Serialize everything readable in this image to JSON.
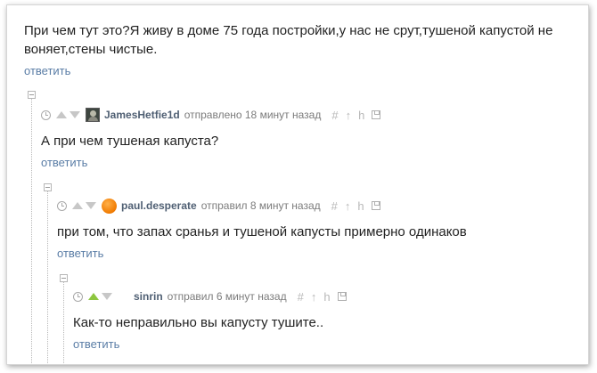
{
  "top_comment": {
    "text": "При чем тут это?Я живу в доме 75 года постройки,у нас не срут,тушеной капустой не воняет,стены чистые.",
    "reply_label": "ответить"
  },
  "comments": [
    {
      "username": "JamesHetfie1d",
      "action": "отправлено 18 минут назад",
      "text": "А при чем тушеная капуста?",
      "reply_label": "ответить",
      "avatar": "user-photo"
    },
    {
      "username": "paul.desperate",
      "action": "отправил 8 минут назад",
      "text": "при том, что запах сранья и тушеной капусты примерно одинаков",
      "reply_label": "ответить",
      "avatar": "orange-circle"
    },
    {
      "username": "sinrin",
      "action": "отправил 6 минут назад",
      "text": "Как-то неправильно вы капусту тушите..",
      "reply_label": "ответить",
      "avatar": "none"
    }
  ],
  "tools": {
    "hash": "#",
    "up": "↑",
    "branch": "h"
  },
  "colors": {
    "link": "#5a7da6",
    "username": "#4f5f73",
    "upvote_active": "#8dc63f",
    "avatar_orange": "#f07a00"
  }
}
